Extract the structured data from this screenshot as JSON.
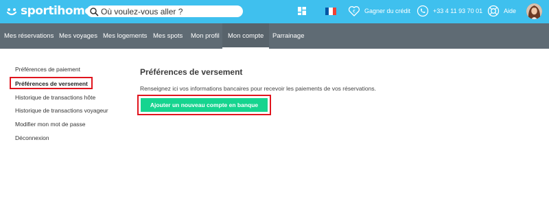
{
  "header": {
    "brand": "sportihome",
    "search": {
      "placeholder": "Où voulez-vous aller ?"
    },
    "credit_label": "Gagner du crédit",
    "phone": "+33 4 11 93 70 01",
    "help_label": "Aide",
    "flag_colors": [
      "#0055a4",
      "#ffffff",
      "#ef4135"
    ],
    "bar_color": "#3fc0ee"
  },
  "nav": {
    "items": [
      {
        "label": "Mes réservations"
      },
      {
        "label": "Mes voyages"
      },
      {
        "label": "Mes logements"
      },
      {
        "label": "Mes spots"
      },
      {
        "label": "Mon profil"
      },
      {
        "label": "Mon compte",
        "active": true
      },
      {
        "label": "Parrainage"
      }
    ],
    "bar_color": "#5f6b74"
  },
  "sidebar": {
    "items": [
      {
        "label": "Préférences de paiement"
      },
      {
        "label": "Préférences de versement",
        "active": true
      },
      {
        "label": "Historique de transactions hôte"
      },
      {
        "label": "Historique de transactions voyageur"
      },
      {
        "label": "Modifier mon mot de passe"
      },
      {
        "label": "Déconnexion"
      }
    ]
  },
  "main": {
    "title": "Préférences de versement",
    "description": "Renseignez ici vos informations bancaires pour recevoir les paiements de vos réservations.",
    "add_button_label": "Ajouter un nouveau compte en banque",
    "button_color": "#16d48f",
    "highlight_color": "#e0141d"
  }
}
